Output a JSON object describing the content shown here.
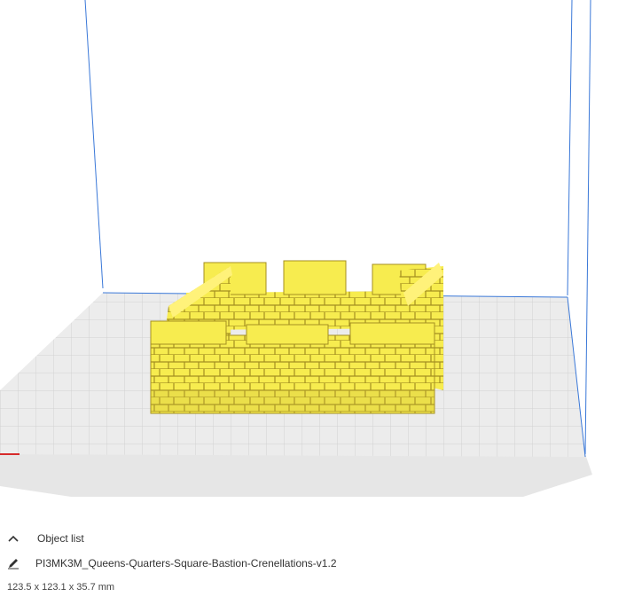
{
  "object_panel": {
    "list_toggle_icon": "chevron-up-icon",
    "list_label": "Object list",
    "edit_icon": "pencil-icon",
    "object_name": "PI3MK3M_Queens-Quarters-Square-Bastion-Crenellations-v1.2",
    "dimensions": "123.5 x 123.1 x 35.7 mm"
  },
  "colors": {
    "model": "#f7ec4f",
    "build_plate": "#e8e8e8",
    "volume_edge": "#3a78d8",
    "x_axis": "#d62a2a"
  }
}
